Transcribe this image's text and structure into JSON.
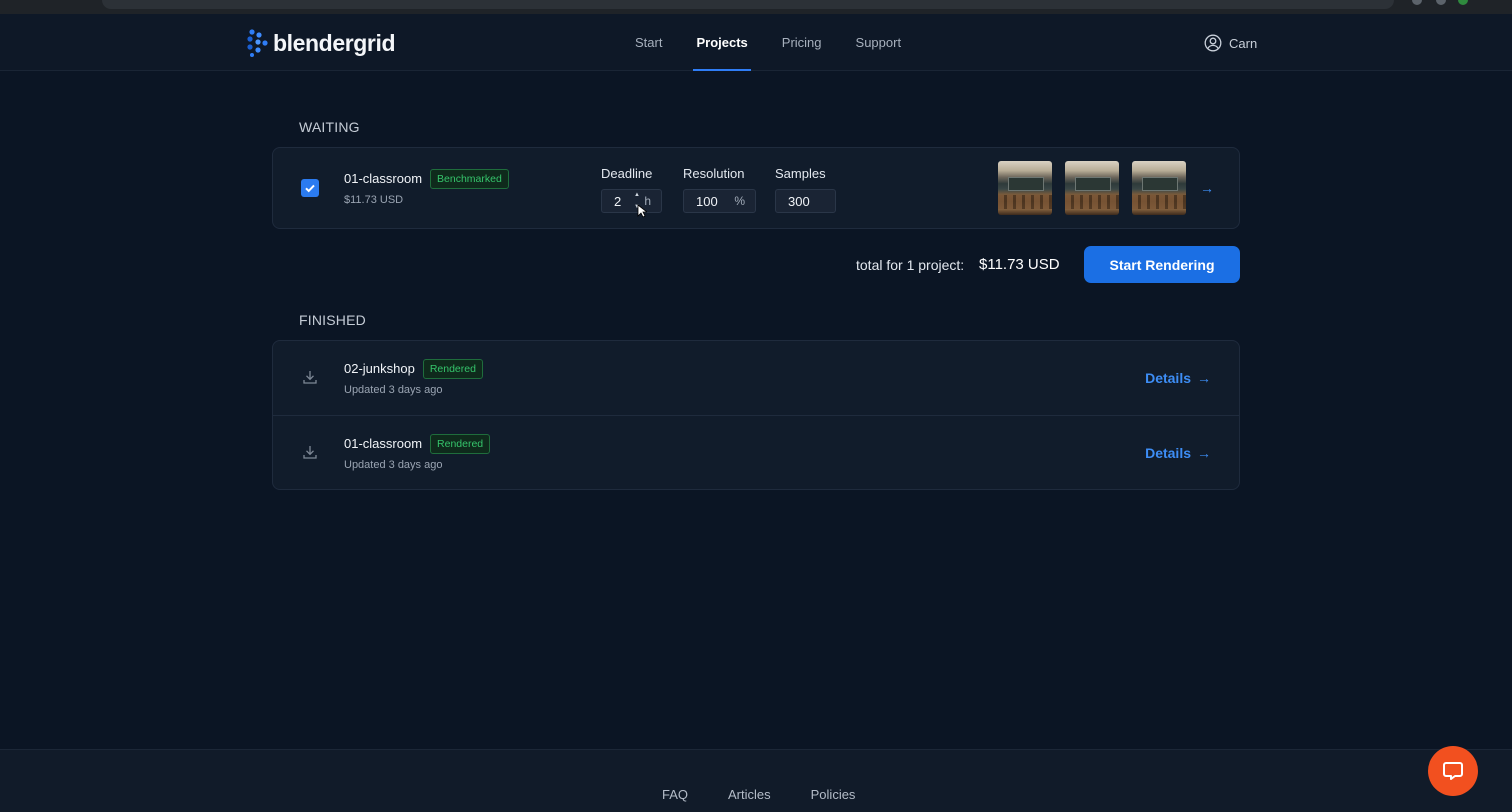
{
  "brand": {
    "name": "blendergrid",
    "accent": "#1b6fe4"
  },
  "nav": {
    "items": [
      {
        "label": "Start",
        "active": false
      },
      {
        "label": "Projects",
        "active": true
      },
      {
        "label": "Pricing",
        "active": false
      },
      {
        "label": "Support",
        "active": false
      }
    ]
  },
  "user": {
    "name": "Carn",
    "icon": "user-circle-icon"
  },
  "waiting": {
    "heading": "WAITING",
    "project": {
      "name": "01-classroom",
      "badge": "Benchmarked",
      "price": "$11.73 USD",
      "checked": true,
      "deadline": {
        "label": "Deadline",
        "value": "2",
        "unit": "h"
      },
      "resolution": {
        "label": "Resolution",
        "value": "100",
        "unit": "%"
      },
      "samples": {
        "label": "Samples",
        "value": "300"
      },
      "thumbnails": 3
    },
    "total_label": "total for 1 project:",
    "total_value": "$11.73 USD",
    "start_button": "Start Rendering"
  },
  "finished": {
    "heading": "FINISHED",
    "projects": [
      {
        "name": "02-junkshop",
        "badge": "Rendered",
        "updated": "Updated 3 days ago",
        "details": "Details"
      },
      {
        "name": "01-classroom",
        "badge": "Rendered",
        "updated": "Updated 3 days ago",
        "details": "Details"
      }
    ]
  },
  "footer": {
    "links": [
      "FAQ",
      "Articles",
      "Policies"
    ]
  },
  "colors": {
    "background": "#0b1524",
    "card": "#111c2b",
    "badge_green": "#35c46b",
    "link_blue": "#3d8df5",
    "chat": "#f2501f"
  }
}
